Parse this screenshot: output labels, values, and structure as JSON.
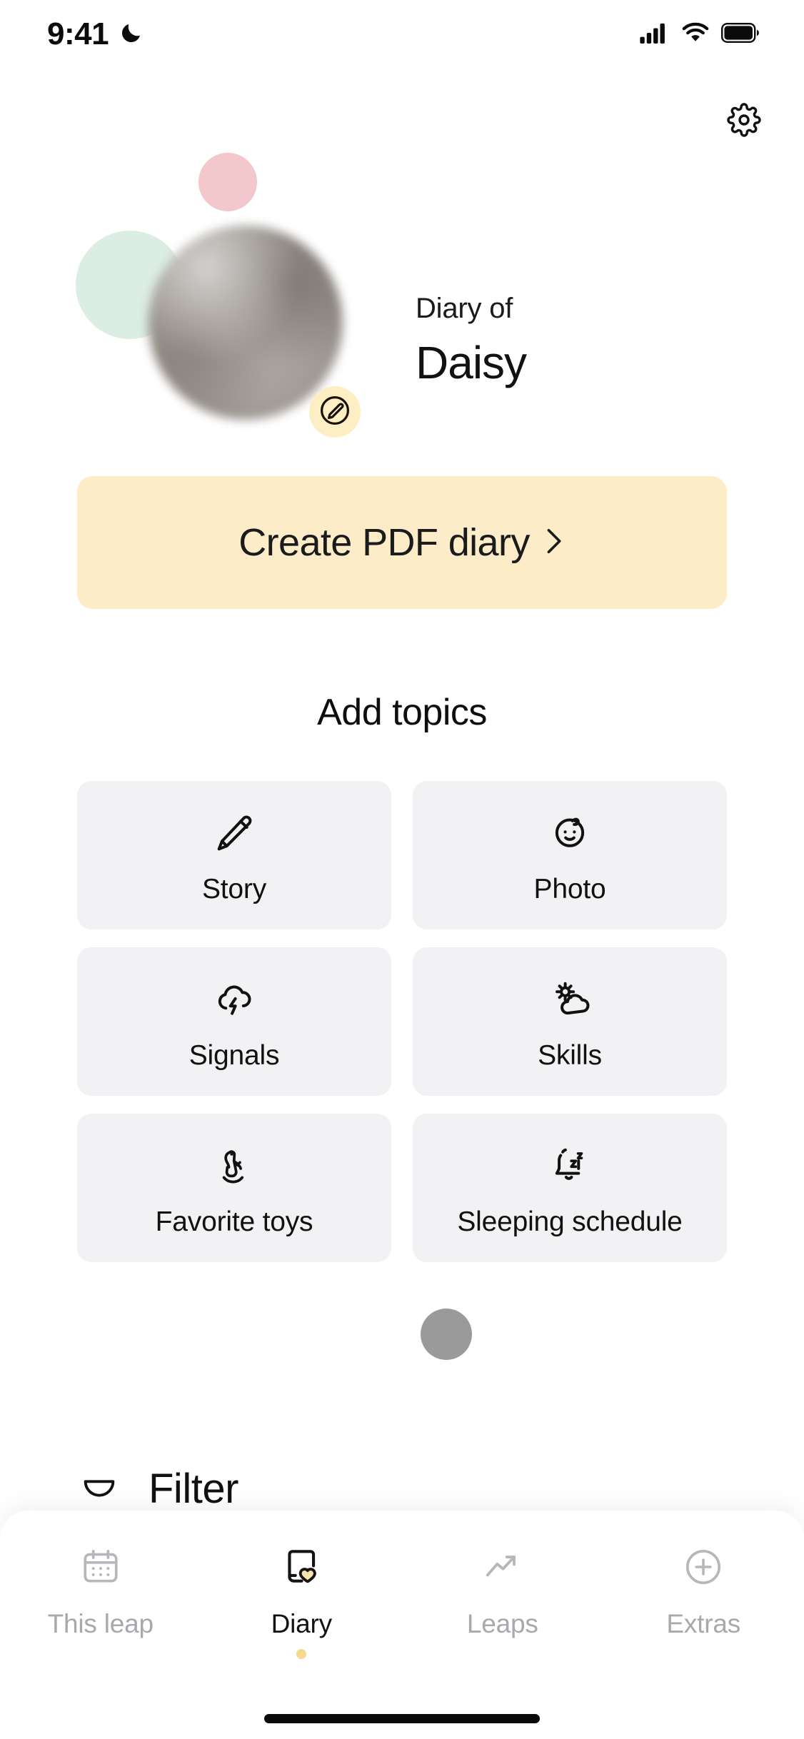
{
  "status_bar": {
    "time": "9:41",
    "moon_icon": "crescent-moon-icon",
    "cellular_icon": "cellular-signal-icon",
    "wifi_icon": "wifi-icon",
    "battery_icon": "battery-full-icon"
  },
  "header": {
    "settings_icon": "gear-icon"
  },
  "hero": {
    "eyebrow": "Diary of",
    "name": "Daisy",
    "avatar_icon": "avatar-photo",
    "edit_icon": "pencil-circle-icon",
    "deco_pink_color": "#f2c8cc",
    "deco_mint_color": "#dceee4",
    "edit_badge_color": "#fdeec4"
  },
  "cta": {
    "label": "Create PDF diary",
    "chevron_icon": "chevron-right-icon",
    "background_color": "#fcecc8"
  },
  "topics": {
    "title": "Add topics",
    "card_color": "#f2f1f3",
    "items": [
      {
        "label": "Story",
        "icon": "pencil-icon"
      },
      {
        "label": "Photo",
        "icon": "baby-face-icon"
      },
      {
        "label": "Signals",
        "icon": "storm-cloud-icon"
      },
      {
        "label": "Skills",
        "icon": "sun-cloud-icon"
      },
      {
        "label": "Favorite toys",
        "icon": "rocking-horse-icon"
      },
      {
        "label": "Sleeping schedule",
        "icon": "bell-sleep-icon"
      }
    ]
  },
  "loader": {
    "dot_color": "#9a9a9a"
  },
  "filter": {
    "label": "Filter",
    "icon": "funnel-icon"
  },
  "tabbar": {
    "active_dot_color": "#f6d98e",
    "items": [
      {
        "label": "This leap",
        "icon": "calendar-icon",
        "active": false
      },
      {
        "label": "Diary",
        "icon": "book-heart-icon",
        "active": true
      },
      {
        "label": "Leaps",
        "icon": "trending-up-icon",
        "active": false
      },
      {
        "label": "Extras",
        "icon": "plus-circle-icon",
        "active": false
      }
    ]
  },
  "home_indicator": "home-indicator"
}
